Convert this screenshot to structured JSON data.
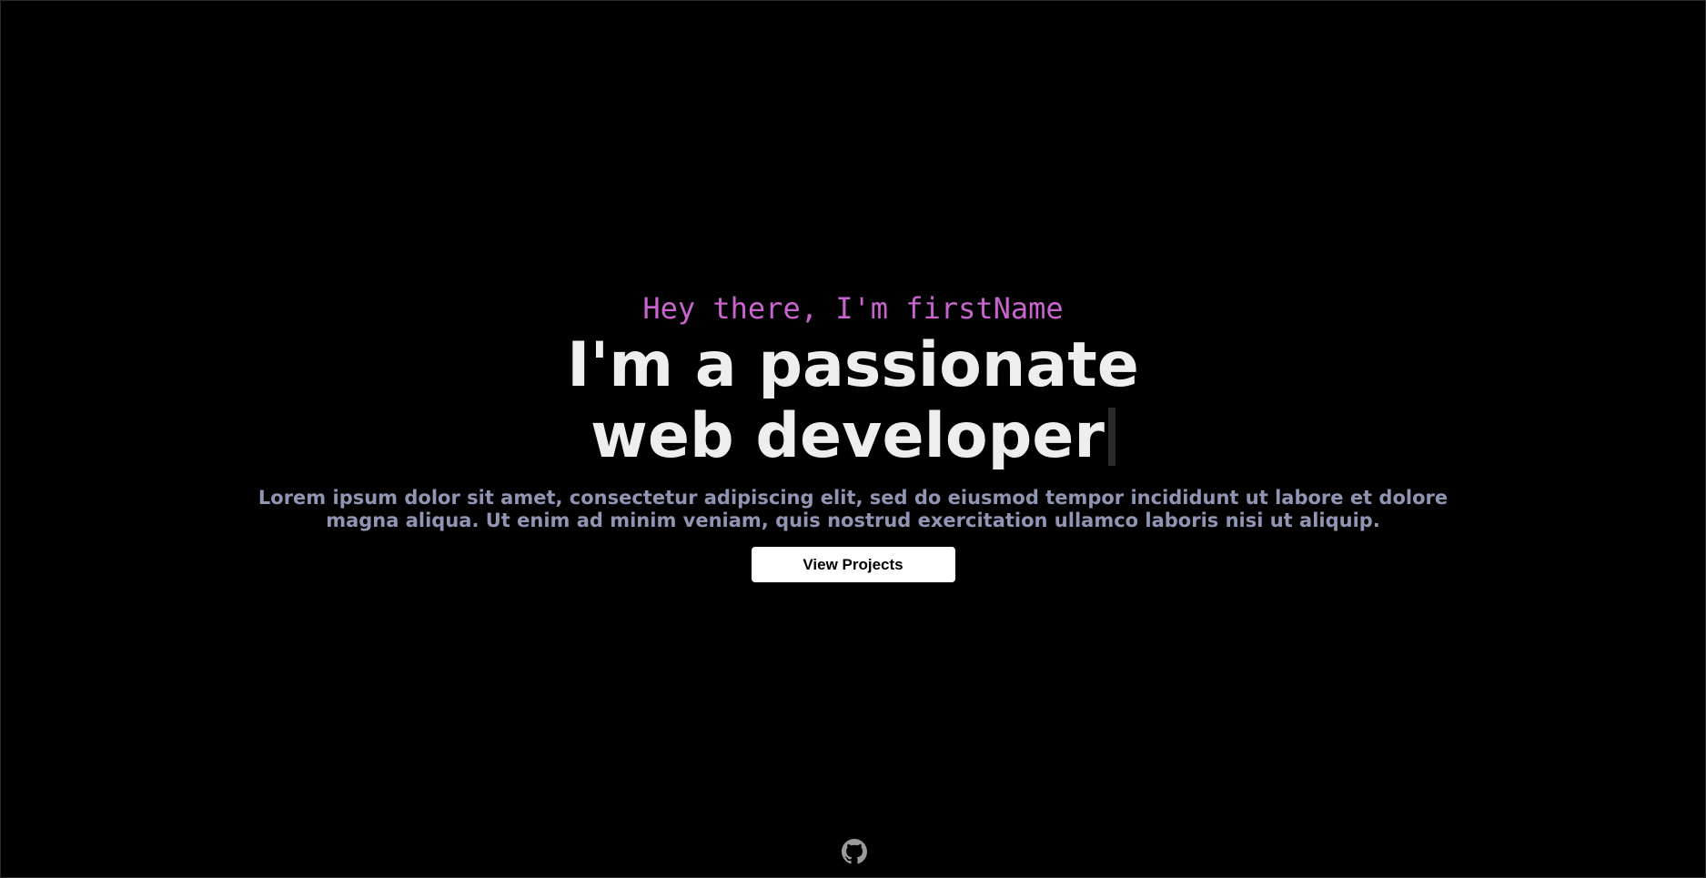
{
  "hero": {
    "greeting": "Hey there, I'm firstName",
    "headline_line1": "I'm a passionate",
    "headline_line2": "web developer",
    "description": "Lorem ipsum dolor sit amet, consectetur adipiscing elit, sed do eiusmod tempor incididunt ut labore et dolore magna aliqua. Ut enim ad minim veniam, quis nostrud exercitation ullamco laboris nisi ut aliquip.",
    "cta_label": "View Projects"
  },
  "footer": {
    "icon": "github-icon"
  },
  "colors": {
    "background": "#000000",
    "greeting": "#c964cf",
    "headline": "#eeeeee",
    "description": "#8f95b2",
    "button_bg": "#ffffff",
    "button_text": "#000000",
    "icon": "#9a9a9a"
  }
}
